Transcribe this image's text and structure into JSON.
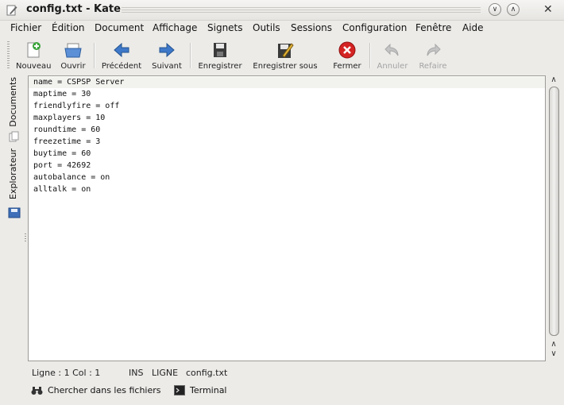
{
  "window": {
    "title": "config.txt - Kate"
  },
  "menubar": {
    "items": [
      {
        "label": "Fichier"
      },
      {
        "label": "Édition"
      },
      {
        "label": "Document"
      },
      {
        "label": "Affichage"
      },
      {
        "label": "Signets"
      },
      {
        "label": "Outils"
      },
      {
        "label": "Sessions"
      },
      {
        "label": "Configuration"
      },
      {
        "label": "Fenêtre"
      },
      {
        "label": "Aide"
      }
    ]
  },
  "toolbar": {
    "buttons": [
      {
        "label": "Nouveau",
        "icon": "new-document-icon",
        "enabled": true
      },
      {
        "label": "Ouvrir",
        "icon": "open-folder-icon",
        "enabled": true
      },
      {
        "label": "Précédent",
        "icon": "arrow-left-icon",
        "enabled": true
      },
      {
        "label": "Suivant",
        "icon": "arrow-right-icon",
        "enabled": true
      },
      {
        "label": "Enregistrer",
        "icon": "save-icon",
        "enabled": true
      },
      {
        "label": "Enregistrer sous",
        "icon": "save-as-icon",
        "enabled": true
      },
      {
        "label": "Fermer",
        "icon": "close-icon",
        "enabled": true
      },
      {
        "label": "Annuler",
        "icon": "undo-icon",
        "enabled": false
      },
      {
        "label": "Refaire",
        "icon": "redo-icon",
        "enabled": false
      }
    ]
  },
  "side_panel": {
    "tabs": [
      {
        "label": "Documents",
        "icon": "documents-icon"
      },
      {
        "label": "Explorateur",
        "icon": "file-explorer-icon"
      }
    ]
  },
  "editor": {
    "lines": [
      "name = CSPSP Server",
      "maptime = 30",
      "friendlyfire = off",
      "maxplayers = 10",
      "roundtime = 60",
      "freezetime = 3",
      "buytime = 60",
      "port = 42692",
      "autobalance = on",
      "alltalk = on"
    ]
  },
  "statusbar": {
    "position": "Ligne : 1 Col : 1",
    "mode": "INS",
    "selection_mode": "LIGNE",
    "filename": "config.txt"
  },
  "bottom_tools": {
    "find_in_files": "Chercher dans les fichiers",
    "terminal": "Terminal"
  },
  "colors": {
    "window_bg": "#ecebe8",
    "editor_bg": "#ffffff",
    "close_red": "#d42323",
    "nav_blue": "#3e78c9",
    "new_green": "#3aa33a"
  }
}
